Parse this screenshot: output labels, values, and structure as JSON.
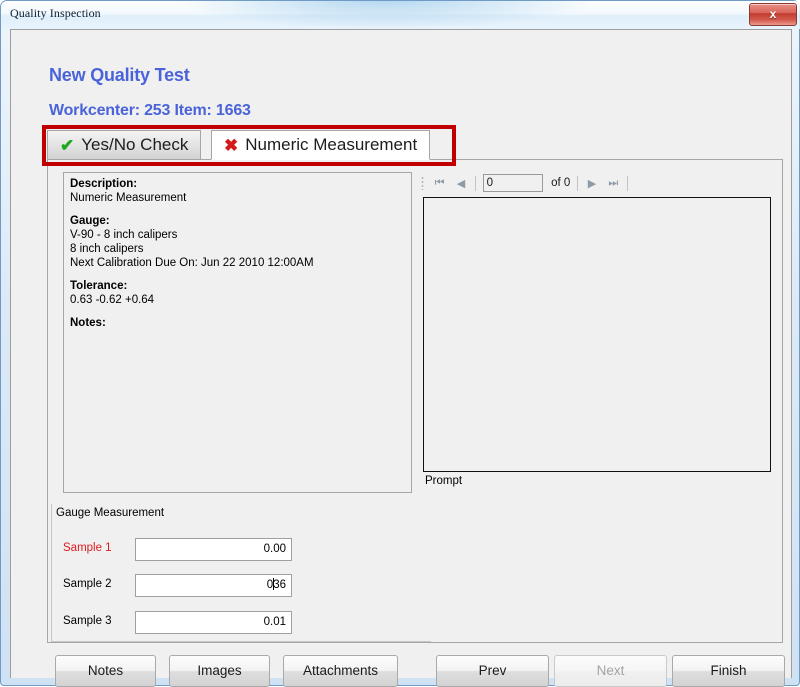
{
  "window": {
    "title": "Quality Inspection",
    "close_label": "x"
  },
  "header": {
    "title": "New Quality Test",
    "subtitle": "Workcenter: 253 Item: 1663",
    "accent_color": "#4a63d8"
  },
  "tabs": [
    {
      "label": "Yes/No Check",
      "icon": "check-icon",
      "glyph": "✔",
      "status_color": "#1fa81f",
      "selected": false
    },
    {
      "label": "Numeric Measurement",
      "icon": "cross-icon",
      "glyph": "✖",
      "status_color": "#d51a1a",
      "selected": true
    }
  ],
  "highlight": {
    "color": "#c00000"
  },
  "description_panel": {
    "lines": [
      {
        "text": "Description:",
        "bold": true
      },
      {
        "text": "Numeric Measurement",
        "bold": false
      },
      {
        "text": "",
        "bold": false
      },
      {
        "text": "Gauge:",
        "bold": true
      },
      {
        "text": "V-90 - 8 inch calipers",
        "bold": false
      },
      {
        "text": "8 inch calipers",
        "bold": false
      },
      {
        "text": "Next Calibration Due On: Jun 22 2010 12:00AM",
        "bold": false
      },
      {
        "text": "",
        "bold": false
      },
      {
        "text": "Tolerance:",
        "bold": true
      },
      {
        "text": "0.63 -0.62 +0.64",
        "bold": false
      },
      {
        "text": "",
        "bold": false
      },
      {
        "text": "Notes:",
        "bold": true
      }
    ]
  },
  "navigator": {
    "first_glyph": "⏮",
    "prev_glyph": "◀",
    "next_glyph": "▶",
    "last_glyph": "⏭",
    "record_value": "0",
    "record_placeholder": "0",
    "of_label": "of 0"
  },
  "prompt": {
    "label": "Prompt",
    "value": ""
  },
  "gauge_measurement": {
    "group_label": "Gauge Measurement",
    "samples": [
      {
        "label": "Sample 1",
        "value": "0.00",
        "error": true,
        "caret": false
      },
      {
        "label": "Sample 2",
        "value_before": "0",
        "value_after": "36",
        "value": "0.36",
        "error": false,
        "caret": true
      },
      {
        "label": "Sample 3",
        "value": "0.01",
        "error": false,
        "caret": false
      }
    ]
  },
  "buttons": {
    "notes": "Notes",
    "images": "Images",
    "attachments": "Attachments",
    "prev": "Prev",
    "next": "Next",
    "finish": "Finish"
  }
}
